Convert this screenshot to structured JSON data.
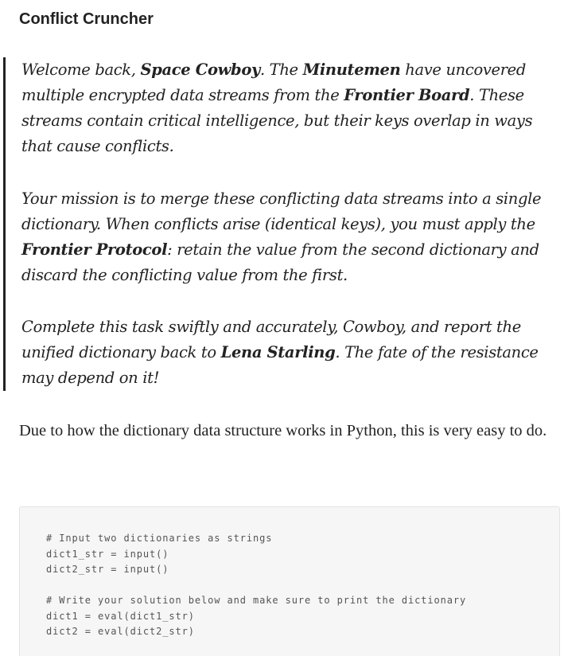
{
  "title": "Conflict Cruncher",
  "quote": {
    "p1": {
      "t1": "Welcome back, ",
      "b1": "Space Cowboy",
      "t2": ". The ",
      "b2": "Minutemen",
      "t3": " have uncovered multiple encrypted data streams from the ",
      "b3": "Frontier Board",
      "t4": ". These streams contain critical intelligence, but their keys overlap in ways that cause conflicts."
    },
    "p2": {
      "t1": "Your mission is to merge these conflicting data streams into a single dictionary. When conflicts arise (identical keys), you must apply the ",
      "b1": "Frontier Protocol",
      "t2": ": retain the value from the second dictionary and discard the conflicting value from the first."
    },
    "p3": {
      "t1": "Complete this task swiftly and accurately, Cowboy, and report the unified dictionary back to ",
      "b1": "Lena Starling",
      "t2": ". The fate of the resistance may depend on it!"
    }
  },
  "body_text": "Due to how the dictionary data structure works in Python, this is very easy to do.",
  "code": {
    "lines": [
      "# Input two dictionaries as strings",
      "dict1_str = input()",
      "dict2_str = input()",
      "",
      "# Write your solution below and make sure to print the dictionary",
      "dict1 = eval(dict1_str)",
      "dict2 = eval(dict2_str)"
    ]
  }
}
